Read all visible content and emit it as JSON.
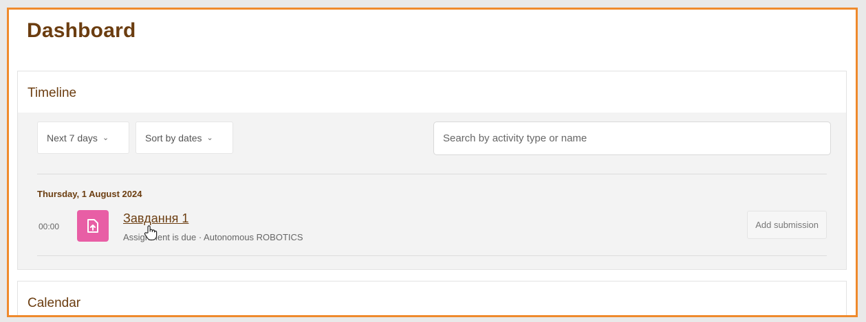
{
  "page": {
    "title": "Dashboard"
  },
  "timeline": {
    "header": "Timeline",
    "filter_days": "Next 7 days",
    "sort": "Sort by dates",
    "search_placeholder": "Search by activity type or name",
    "date_heading": "Thursday, 1 August 2024",
    "events": [
      {
        "time": "00:00",
        "icon": "assignment-upload-icon",
        "name": "Завдання 1",
        "meta": "Assignment is due · Autonomous ROBOTICS",
        "action": "Add submission"
      }
    ]
  },
  "calendar": {
    "header": "Calendar"
  },
  "colors": {
    "highlight_border": "#ef8a2c",
    "brand_text": "#6b3d10",
    "assignment_icon_bg": "#e85ea5"
  }
}
